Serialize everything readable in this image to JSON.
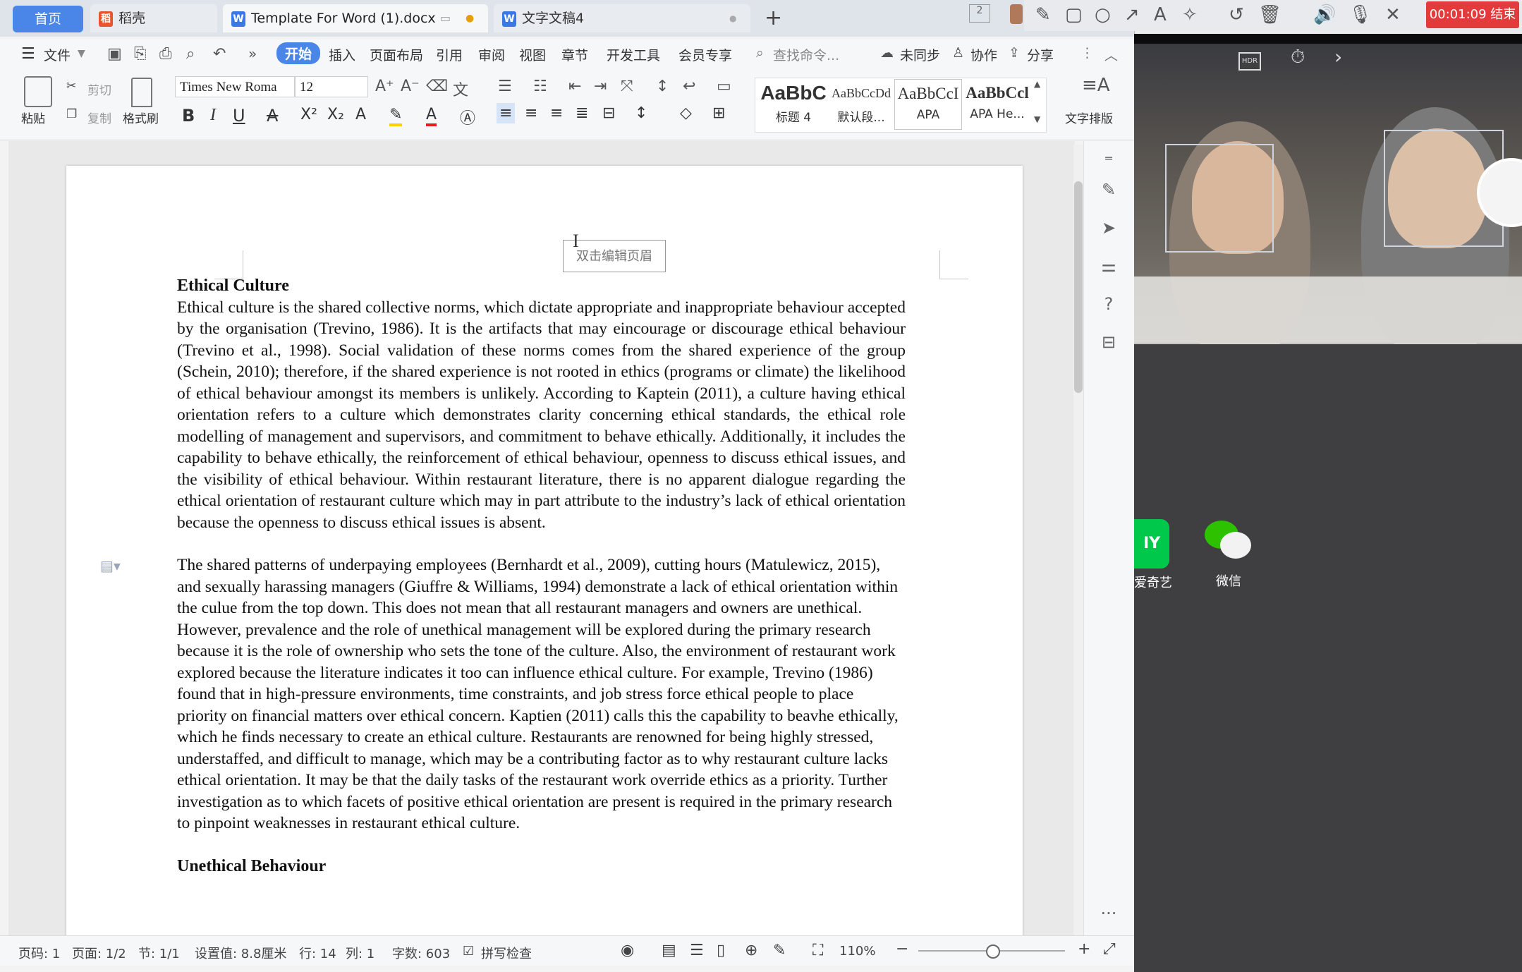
{
  "tabs": {
    "home": "首页",
    "items": [
      {
        "label": "稻壳"
      },
      {
        "label": "Template For Word  (1).docx"
      },
      {
        "label": "文字文稿4"
      }
    ]
  },
  "menu": {
    "file": "文件",
    "items": [
      "开始",
      "插入",
      "页面布局",
      "引用",
      "审阅",
      "视图",
      "章节",
      "开发工具",
      "会员专享"
    ],
    "search_placeholder": "查找命令...",
    "sync": "未同步",
    "collab": "协作",
    "share": "分享"
  },
  "ribbon": {
    "paste": "粘贴",
    "cut": "剪切",
    "copy": "复制",
    "format_painter": "格式刷",
    "font_name": "Times New Roma",
    "font_size": "12",
    "styles": [
      {
        "preview": "AaBbC",
        "name": "标题 4"
      },
      {
        "preview": "AaBbCcDd",
        "name": "默认段..."
      },
      {
        "preview": "AaBbCcI",
        "name": "APA"
      },
      {
        "preview": "AaBbCcl",
        "name": "APA He..."
      }
    ],
    "text_layout": "文字排版"
  },
  "document": {
    "header_hint": "双击编辑页眉",
    "heading1": "Ethical Culture",
    "para1": "Ethical culture is the shared collective norms, which dictate appropriate and inappropriate behaviour accepted by the organisation (Trevino, 1986).  It is the artifacts that may eincourage or discourage ethical behaviour (Trevino et al., 1998).  Social validation of these norms comes from the shared experience of the group (Schein, 2010); therefore, if the shared experience is not rooted in ethics (programs or climate) the likelihood of ethical behaviour amongst its members is unlikely.  According to Kaptein (2011), a culture having ethical orientation refers to a culture which demonstrates clarity concerning ethical standards, the ethical role modelling of management and supervisors, and commitment to behave ethically.  Additionally, it includes the capability to behave ethically, the reinforcement of ethical behaviour, openness to discuss ethical issues, and the visibility of ethical behaviour.   Within restaurant literature, there is no apparent dialogue regarding the ethical orientation of restaurant culture which may in part attribute to the industry’s lack of ethical orientation because the openness to discuss ethical issues is absent.",
    "para2": "The shared patterns of underpaying employees (Bernhardt et al., 2009), cutting hours (Matulewicz, 2015), and sexually harassing managers (Giuffre & Williams, 1994) demonstrate a lack of ethical orientation within the culue from the top down.  This does not mean that all restaurant managers and owners are unethical.  However, prevalence and the role of unethical management will be explored during the primary research because it is the role of ownership who sets the tone of the culture.  Also, the environment of restaurant work explored because the literature indicates it too can influence ethical culture.  For example, Trevino (1986) found that in high-pressure environments, time constraints, and job stress force ethical people to place priority on financial matters over ethical concern.  Kaptien (2011) calls this the capability to beavhe ethically, which he finds necessary to create an ethical culture.  Restaurants are renowned for being highly stressed, understaffed, and difficult to manage, which may be a contributing factor as to why restaurant culture lacks ethical orientation.  It may be that the daily tasks of the restaurant work override ethics as a priority.  Turther investigation as to which facets of positive ethical orientation are present is required in the primary research to pinpoint weaknesses in restaurant ethical culture.",
    "heading2": "Unethical Behaviour"
  },
  "status": {
    "page_code": "页码: 1",
    "page": "页面: 1/2",
    "section": "节: 1/1",
    "setting": "设置值: 8.8厘米",
    "row": "行: 14",
    "col": "列: 1",
    "word_count": "字数: 603",
    "spell_check": "拼写检查",
    "zoom": "110%"
  },
  "meeting": {
    "timer": "00:01:09 结束",
    "hdr_label": "HDR"
  },
  "desktop": {
    "icons": [
      {
        "label": "爱奇艺"
      },
      {
        "label": "微信"
      }
    ]
  },
  "colors": {
    "accent": "#4a86e8",
    "record": "#e33b3b",
    "desktop_bg": "#3f3f41"
  }
}
